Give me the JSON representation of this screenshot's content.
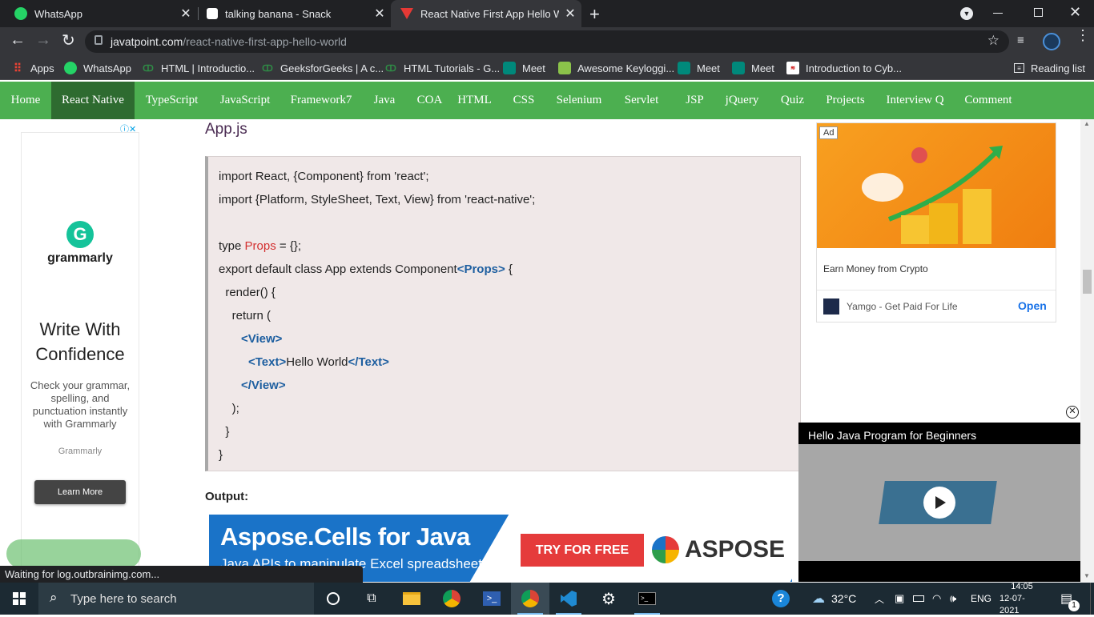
{
  "browser": {
    "tabs": [
      {
        "title": "WhatsApp"
      },
      {
        "title": "talking banana - Snack"
      },
      {
        "title": "React Native First App Hello World"
      }
    ],
    "new_tab_symbol": "+",
    "url_host": "javatpoint.com",
    "url_path": "/react-native-first-app-hello-world",
    "bookmarks": [
      {
        "label": "Apps"
      },
      {
        "label": "WhatsApp"
      },
      {
        "label": "HTML | Introductio..."
      },
      {
        "label": "GeeksforGeeks | A c..."
      },
      {
        "label": "HTML Tutorials - G..."
      },
      {
        "label": "Meet"
      },
      {
        "label": "Awesome Keyloggi..."
      },
      {
        "label": "Meet"
      },
      {
        "label": "Meet"
      },
      {
        "label": "Introduction to Cyb..."
      }
    ],
    "reading_list": "Reading list",
    "status_text": "Waiting for log.outbrainimg.com..."
  },
  "site_nav": {
    "items": [
      "Home",
      "React Native",
      "TypeScript",
      "JavaScript",
      "Framework7",
      "Java",
      "COA",
      "HTML",
      "CSS",
      "Selenium",
      "Servlet",
      "JSP",
      "jQuery",
      "Quiz",
      "Projects",
      "Interview Q",
      "Comment"
    ],
    "active": "React Native"
  },
  "article": {
    "file_heading": "App.js",
    "code": {
      "line1": "import React, {Component} from 'react';",
      "line2": "import {Platform, StyleSheet, Text, View} from 'react-native';",
      "l4_a": "type ",
      "l4_b": "Props",
      "l4_c": " = {};",
      "l5_a": "export default class App extends Component",
      "l5_b": "<Props>",
      "l5_c": " {",
      "l6": "  render() {",
      "l7": "    return (",
      "l8": "<View>",
      "l9_open": "<Text>",
      "l9_text": "Hello World",
      "l9_close": "</Text>",
      "l10": "</View>",
      "l11": "    );",
      "l12": "  }",
      "l13": "}"
    },
    "output_label": "Output:"
  },
  "left_ad": {
    "brand": "grammarly",
    "headline": "Write With Confidence",
    "body": "Check your grammar, spelling, and punctuation instantly with Grammarly",
    "advertiser": "Grammarly",
    "cta": "Learn More"
  },
  "right_ad": {
    "badge": "Ad",
    "caption": "Earn Money from Crypto",
    "advertiser": "Yamgo - Get Paid For Life",
    "cta": "Open"
  },
  "bottom_ad": {
    "title": "Aspose.Cells for Java",
    "subtitle": "Java APIs to manipulate Excel spreadsheets",
    "cta": "TRY FOR FREE",
    "brand": "ASPOSE"
  },
  "video": {
    "title": "Hello Java Program for Beginners"
  },
  "taskbar": {
    "search_placeholder": "Type here to search",
    "temperature": "32°C",
    "language": "ENG",
    "time": "14:05",
    "date": "12-07-2021",
    "notification_count": "1"
  },
  "colors": {
    "nav_green": "#4caf50",
    "nav_active": "#2e6b30",
    "code_bg": "#f0e8e8",
    "tag_blue": "#1e5fa0",
    "props_red": "#d32f2f"
  }
}
